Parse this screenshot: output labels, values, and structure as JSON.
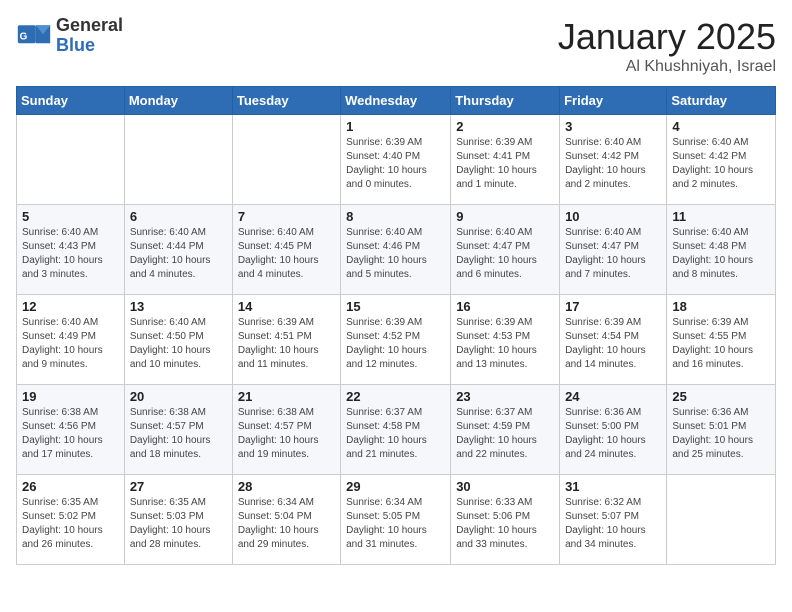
{
  "header": {
    "logo_general": "General",
    "logo_blue": "Blue",
    "month": "January 2025",
    "location": "Al Khushniyah, Israel"
  },
  "weekdays": [
    "Sunday",
    "Monday",
    "Tuesday",
    "Wednesday",
    "Thursday",
    "Friday",
    "Saturday"
  ],
  "weeks": [
    [
      {
        "day": "",
        "info": ""
      },
      {
        "day": "",
        "info": ""
      },
      {
        "day": "",
        "info": ""
      },
      {
        "day": "1",
        "info": "Sunrise: 6:39 AM\nSunset: 4:40 PM\nDaylight: 10 hours\nand 0 minutes."
      },
      {
        "day": "2",
        "info": "Sunrise: 6:39 AM\nSunset: 4:41 PM\nDaylight: 10 hours\nand 1 minute."
      },
      {
        "day": "3",
        "info": "Sunrise: 6:40 AM\nSunset: 4:42 PM\nDaylight: 10 hours\nand 2 minutes."
      },
      {
        "day": "4",
        "info": "Sunrise: 6:40 AM\nSunset: 4:42 PM\nDaylight: 10 hours\nand 2 minutes."
      }
    ],
    [
      {
        "day": "5",
        "info": "Sunrise: 6:40 AM\nSunset: 4:43 PM\nDaylight: 10 hours\nand 3 minutes."
      },
      {
        "day": "6",
        "info": "Sunrise: 6:40 AM\nSunset: 4:44 PM\nDaylight: 10 hours\nand 4 minutes."
      },
      {
        "day": "7",
        "info": "Sunrise: 6:40 AM\nSunset: 4:45 PM\nDaylight: 10 hours\nand 4 minutes."
      },
      {
        "day": "8",
        "info": "Sunrise: 6:40 AM\nSunset: 4:46 PM\nDaylight: 10 hours\nand 5 minutes."
      },
      {
        "day": "9",
        "info": "Sunrise: 6:40 AM\nSunset: 4:47 PM\nDaylight: 10 hours\nand 6 minutes."
      },
      {
        "day": "10",
        "info": "Sunrise: 6:40 AM\nSunset: 4:47 PM\nDaylight: 10 hours\nand 7 minutes."
      },
      {
        "day": "11",
        "info": "Sunrise: 6:40 AM\nSunset: 4:48 PM\nDaylight: 10 hours\nand 8 minutes."
      }
    ],
    [
      {
        "day": "12",
        "info": "Sunrise: 6:40 AM\nSunset: 4:49 PM\nDaylight: 10 hours\nand 9 minutes."
      },
      {
        "day": "13",
        "info": "Sunrise: 6:40 AM\nSunset: 4:50 PM\nDaylight: 10 hours\nand 10 minutes."
      },
      {
        "day": "14",
        "info": "Sunrise: 6:39 AM\nSunset: 4:51 PM\nDaylight: 10 hours\nand 11 minutes."
      },
      {
        "day": "15",
        "info": "Sunrise: 6:39 AM\nSunset: 4:52 PM\nDaylight: 10 hours\nand 12 minutes."
      },
      {
        "day": "16",
        "info": "Sunrise: 6:39 AM\nSunset: 4:53 PM\nDaylight: 10 hours\nand 13 minutes."
      },
      {
        "day": "17",
        "info": "Sunrise: 6:39 AM\nSunset: 4:54 PM\nDaylight: 10 hours\nand 14 minutes."
      },
      {
        "day": "18",
        "info": "Sunrise: 6:39 AM\nSunset: 4:55 PM\nDaylight: 10 hours\nand 16 minutes."
      }
    ],
    [
      {
        "day": "19",
        "info": "Sunrise: 6:38 AM\nSunset: 4:56 PM\nDaylight: 10 hours\nand 17 minutes."
      },
      {
        "day": "20",
        "info": "Sunrise: 6:38 AM\nSunset: 4:57 PM\nDaylight: 10 hours\nand 18 minutes."
      },
      {
        "day": "21",
        "info": "Sunrise: 6:38 AM\nSunset: 4:57 PM\nDaylight: 10 hours\nand 19 minutes."
      },
      {
        "day": "22",
        "info": "Sunrise: 6:37 AM\nSunset: 4:58 PM\nDaylight: 10 hours\nand 21 minutes."
      },
      {
        "day": "23",
        "info": "Sunrise: 6:37 AM\nSunset: 4:59 PM\nDaylight: 10 hours\nand 22 minutes."
      },
      {
        "day": "24",
        "info": "Sunrise: 6:36 AM\nSunset: 5:00 PM\nDaylight: 10 hours\nand 24 minutes."
      },
      {
        "day": "25",
        "info": "Sunrise: 6:36 AM\nSunset: 5:01 PM\nDaylight: 10 hours\nand 25 minutes."
      }
    ],
    [
      {
        "day": "26",
        "info": "Sunrise: 6:35 AM\nSunset: 5:02 PM\nDaylight: 10 hours\nand 26 minutes."
      },
      {
        "day": "27",
        "info": "Sunrise: 6:35 AM\nSunset: 5:03 PM\nDaylight: 10 hours\nand 28 minutes."
      },
      {
        "day": "28",
        "info": "Sunrise: 6:34 AM\nSunset: 5:04 PM\nDaylight: 10 hours\nand 29 minutes."
      },
      {
        "day": "29",
        "info": "Sunrise: 6:34 AM\nSunset: 5:05 PM\nDaylight: 10 hours\nand 31 minutes."
      },
      {
        "day": "30",
        "info": "Sunrise: 6:33 AM\nSunset: 5:06 PM\nDaylight: 10 hours\nand 33 minutes."
      },
      {
        "day": "31",
        "info": "Sunrise: 6:32 AM\nSunset: 5:07 PM\nDaylight: 10 hours\nand 34 minutes."
      },
      {
        "day": "",
        "info": ""
      }
    ]
  ]
}
